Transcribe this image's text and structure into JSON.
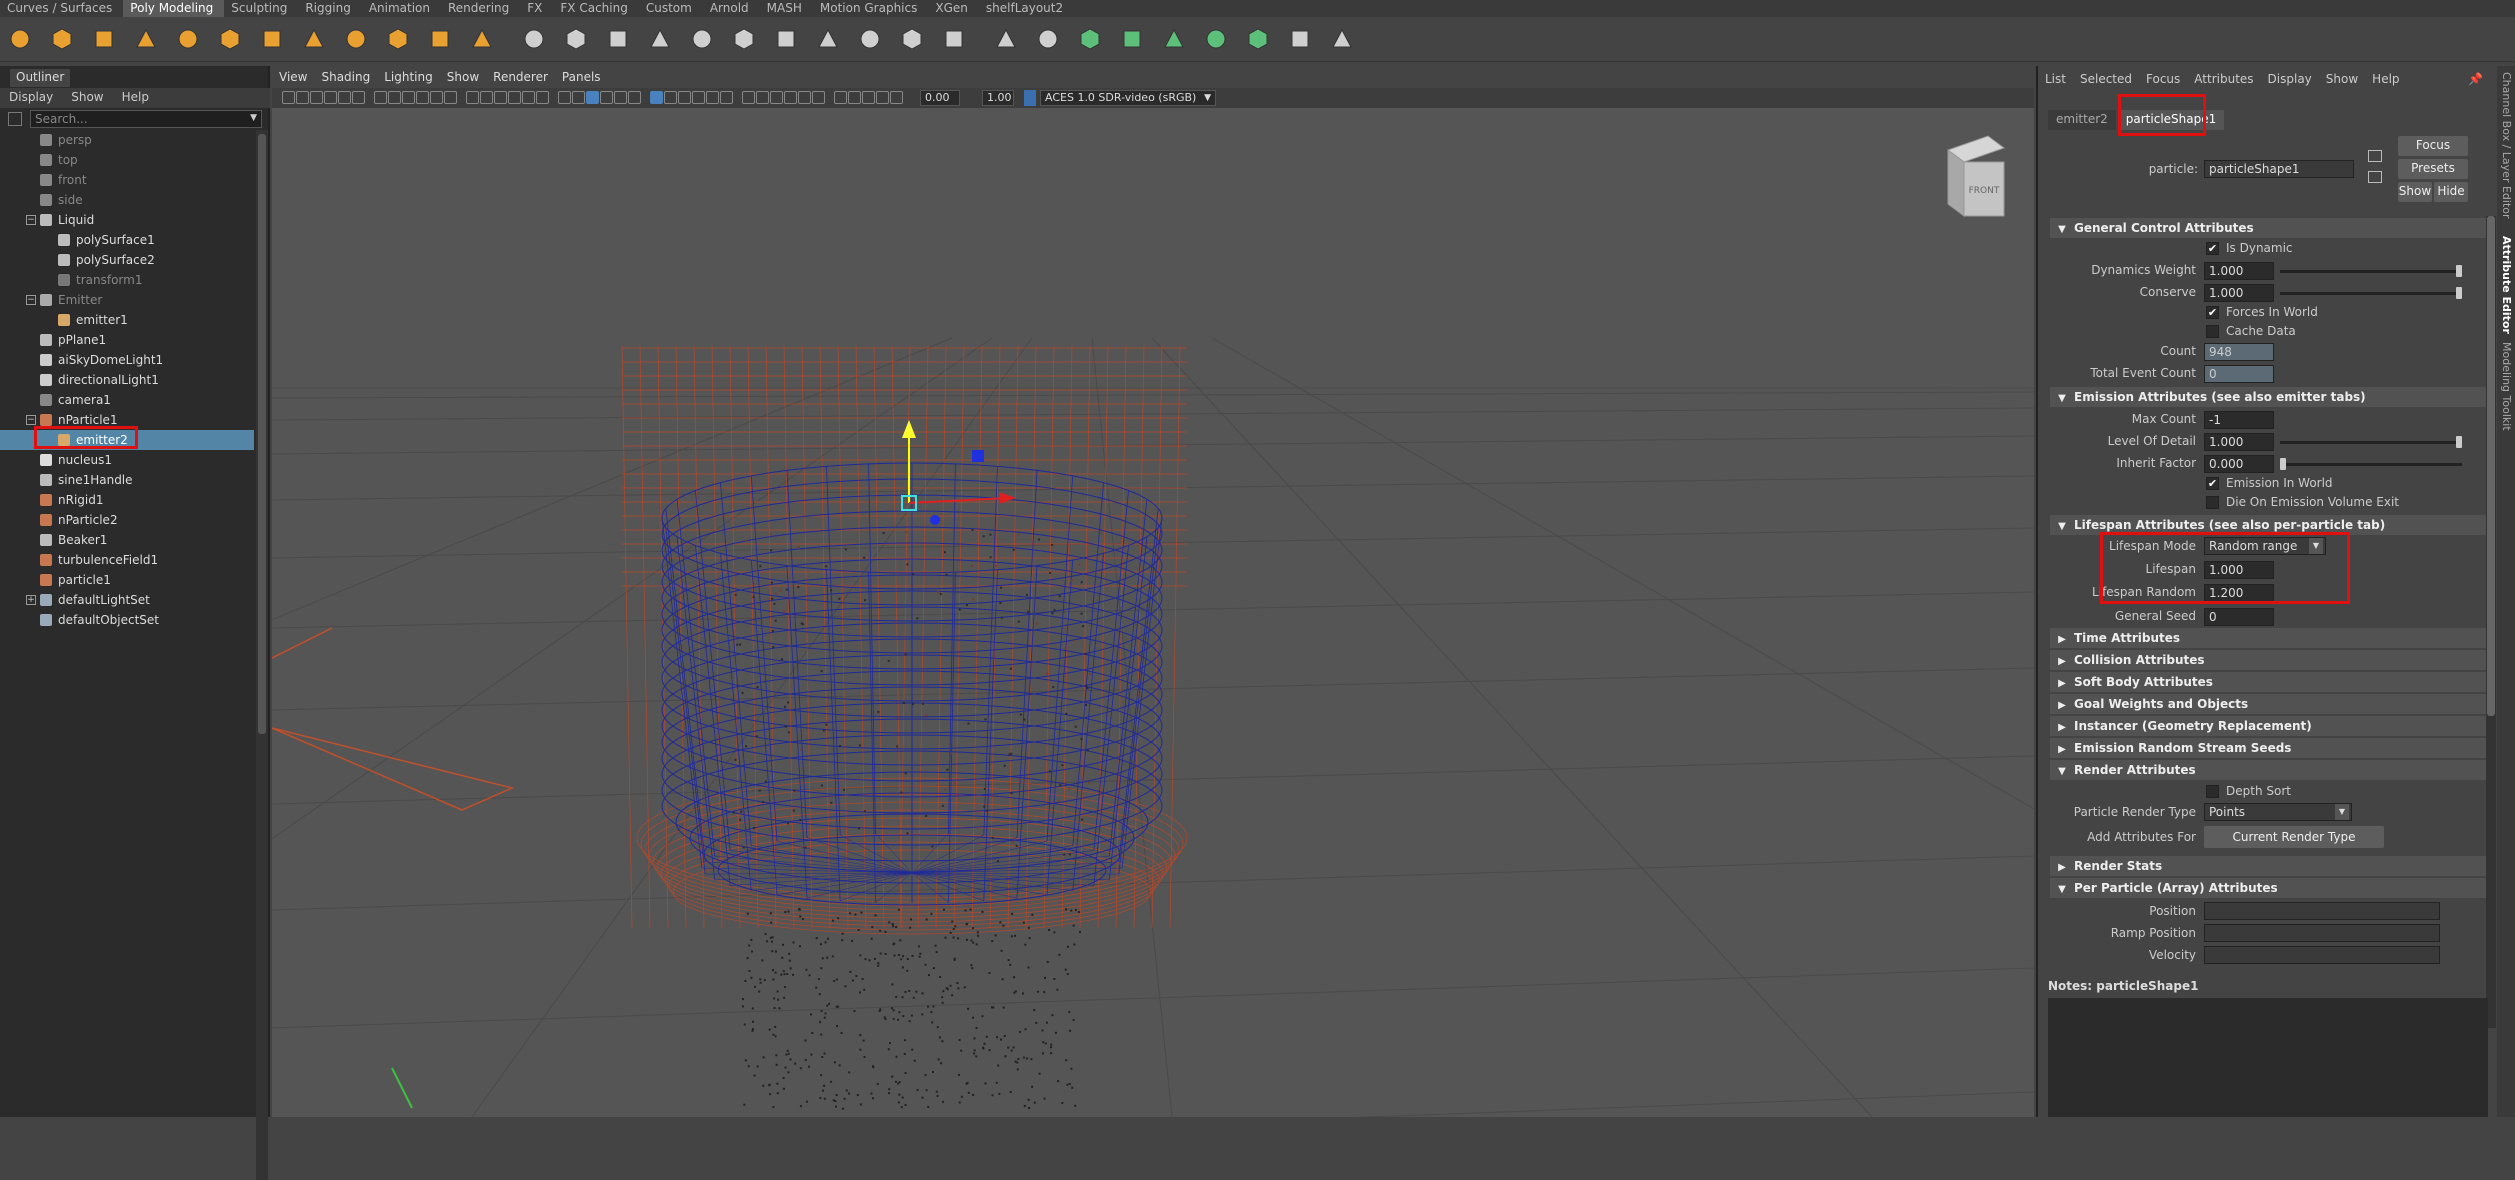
{
  "shelf_tabs": [
    "Curves / Surfaces",
    "Poly Modeling",
    "Sculpting",
    "Rigging",
    "Animation",
    "Rendering",
    "FX",
    "FX Caching",
    "Custom",
    "Arnold",
    "MASH",
    "Motion Graphics",
    "XGen",
    "shelfLayout2"
  ],
  "shelf_active_tab": "Poly Modeling",
  "shelf_icons": [
    "sphere-icon",
    "cube-icon",
    "cylinder-icon",
    "cone-icon",
    "torus-icon",
    "plane-icon",
    "disc-icon",
    "soccerball-icon",
    "sweep-icon",
    "type-icon",
    "svg-icon",
    "superellipse-icon",
    "combine-icon",
    "separate-icon",
    "smooth-icon",
    "extrude-icon",
    "bridge-icon",
    "bevel-icon",
    "fill-hole-icon",
    "append-icon",
    "multicut-icon",
    "target-weld-icon",
    "connect-icon",
    "knife-icon",
    "mirror-icon",
    "uv-icon",
    "crease-icon",
    "bool-icon",
    "reduce-icon",
    "retopo-icon",
    "sculpt-icon",
    "soft-select-icon"
  ],
  "outliner": {
    "title": "Outliner",
    "menu": [
      "Display",
      "Show",
      "Help"
    ],
    "search_placeholder": "Search...",
    "items": [
      {
        "label": "persp",
        "indent": 1,
        "dim": true,
        "icon": "camera-icon"
      },
      {
        "label": "top",
        "indent": 1,
        "dim": true,
        "icon": "camera-icon"
      },
      {
        "label": "front",
        "indent": 1,
        "dim": true,
        "icon": "camera-icon"
      },
      {
        "label": "side",
        "indent": 1,
        "dim": true,
        "icon": "camera-icon"
      },
      {
        "label": "Liquid",
        "indent": 1,
        "expand": "minus",
        "icon": "mesh-icon"
      },
      {
        "label": "polySurface1",
        "indent": 2,
        "icon": "mesh-icon"
      },
      {
        "label": "polySurface2",
        "indent": 2,
        "icon": "mesh-icon"
      },
      {
        "label": "transform1",
        "indent": 2,
        "dim": true,
        "icon": "transform-icon"
      },
      {
        "label": "Emitter",
        "indent": 1,
        "dim": true,
        "expand": "minus",
        "icon": "group-icon"
      },
      {
        "label": "emitter1",
        "indent": 2,
        "icon": "emitter-icon"
      },
      {
        "label": "pPlane1",
        "indent": 1,
        "icon": "mesh-icon"
      },
      {
        "label": "aiSkyDomeLight1",
        "indent": 1,
        "icon": "light-icon"
      },
      {
        "label": "directionalLight1",
        "indent": 1,
        "icon": "light-icon"
      },
      {
        "label": "camera1",
        "indent": 1,
        "icon": "camera-icon"
      },
      {
        "label": "nParticle1",
        "indent": 1,
        "expand": "minus",
        "icon": "particle-icon"
      },
      {
        "label": "emitter2",
        "indent": 2,
        "selected": true,
        "icon": "emitter-icon"
      },
      {
        "label": "nucleus1",
        "indent": 1,
        "icon": "nucleus-icon"
      },
      {
        "label": "sine1Handle",
        "indent": 1,
        "icon": "deformer-icon"
      },
      {
        "label": "nRigid1",
        "indent": 1,
        "icon": "rigid-icon"
      },
      {
        "label": "nParticle2",
        "indent": 1,
        "icon": "particle-icon"
      },
      {
        "label": "Beaker1",
        "indent": 1,
        "icon": "mesh-icon"
      },
      {
        "label": "turbulenceField1",
        "indent": 1,
        "icon": "field-icon"
      },
      {
        "label": "particle1",
        "indent": 1,
        "icon": "particle-icon"
      },
      {
        "label": "defaultLightSet",
        "indent": 1,
        "expand": "plus",
        "icon": "set-icon"
      },
      {
        "label": "defaultObjectSet",
        "indent": 1,
        "icon": "set-icon"
      }
    ]
  },
  "viewport": {
    "menu": [
      "View",
      "Shading",
      "Lighting",
      "Show",
      "Renderer",
      "Panels"
    ],
    "near_value": "0.00",
    "far_value": "1.00",
    "color_space": "ACES 1.0 SDR-video (sRGB)",
    "view_cube_label": "FRONT"
  },
  "attribute_editor": {
    "menu": [
      "List",
      "Selected",
      "Focus",
      "Attributes",
      "Display",
      "Show",
      "Help"
    ],
    "tabs": [
      "emitter2",
      "particleShape1"
    ],
    "active_tab": "particleShape1",
    "node_label": "particle:",
    "node_name": "particleShape1",
    "buttons": {
      "focus": "Focus",
      "presets": "Presets",
      "show": "Show",
      "hide": "Hide"
    },
    "sections": {
      "general": "General Control Attributes",
      "emission": "Emission Attributes (see also emitter tabs)",
      "lifespan": "Lifespan Attributes (see also per-particle tab)",
      "time": "Time Attributes",
      "collision": "Collision Attributes",
      "softbody": "Soft Body Attributes",
      "goal": "Goal Weights and Objects",
      "instancer": "Instancer (Geometry Replacement)",
      "emission_seeds": "Emission Random Stream Seeds",
      "render": "Render Attributes",
      "render_stats": "Render Stats",
      "per_particle": "Per Particle (Array) Attributes"
    },
    "general": {
      "is_dynamic": {
        "label": "Is Dynamic",
        "checked": true
      },
      "dynamics_weight": {
        "label": "Dynamics Weight",
        "value": "1.000",
        "slider": 1.0
      },
      "conserve": {
        "label": "Conserve",
        "value": "1.000",
        "slider": 1.0
      },
      "forces_in_world": {
        "label": "Forces In World",
        "checked": true
      },
      "cache_data": {
        "label": "Cache Data",
        "checked": false
      },
      "count": {
        "label": "Count",
        "value": "948"
      },
      "total_event_count": {
        "label": "Total Event Count",
        "value": "0"
      }
    },
    "emission": {
      "max_count": {
        "label": "Max Count",
        "value": "-1"
      },
      "level_of_detail": {
        "label": "Level Of Detail",
        "value": "1.000",
        "slider": 1.0
      },
      "inherit_factor": {
        "label": "Inherit Factor",
        "value": "0.000",
        "slider": 0.0
      },
      "emission_in_world": {
        "label": "Emission In World",
        "checked": true
      },
      "die_on_exit": {
        "label": "Die On Emission Volume Exit",
        "checked": false
      }
    },
    "lifespan": {
      "mode": {
        "label": "Lifespan Mode",
        "value": "Random range"
      },
      "lifespan": {
        "label": "Lifespan",
        "value": "1.000"
      },
      "random": {
        "label": "Lifespan Random",
        "value": "1.200"
      },
      "seed": {
        "label": "General Seed",
        "value": "0"
      }
    },
    "render": {
      "depth_sort": {
        "label": "Depth Sort",
        "checked": false
      },
      "render_type": {
        "label": "Particle Render Type",
        "value": "Points"
      },
      "add_attrs": {
        "label": "Add Attributes For",
        "button": "Current Render Type"
      }
    },
    "per_particle": {
      "position": "Position",
      "ramp_position": "Ramp Position",
      "velocity": "Velocity"
    },
    "notes_label": "Notes:  particleShape1"
  },
  "side_tabs": [
    "Channel Box / Layer Editor",
    "Attribute Editor",
    "Modeling Toolkit"
  ],
  "colors": {
    "highlight_box": "#e01010",
    "selection": "#5285a6",
    "wire_blue": "#1f2a9a",
    "wire_orange": "#c0502a"
  }
}
